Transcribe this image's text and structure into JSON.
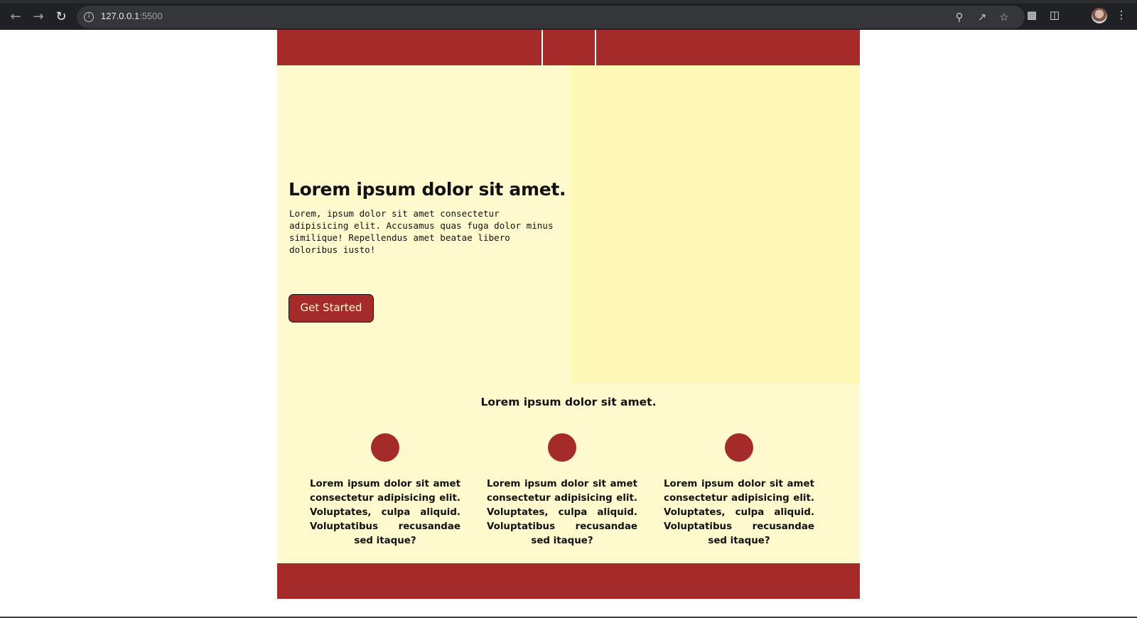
{
  "browser": {
    "url_host": "127.0.0.1",
    "url_port": ":5500"
  },
  "hero": {
    "title": "Lorem ipsum dolor sit amet.",
    "text": "Lorem, ipsum dolor sit amet consectetur adipisicing elit. Accusamus quas fuga dolor minus similique! Repellendus amet beatae libero doloribus iusto!",
    "button_label": "Get Started"
  },
  "features": {
    "title": "Lorem ipsum dolor sit amet.",
    "items": [
      {
        "text": "Lorem ipsum dolor sit amet consectetur adipisicing elit. Voluptates, culpa aliquid. Voluptatibus recusandae sed itaque?"
      },
      {
        "text": "Lorem ipsum dolor sit amet consectetur adipisicing elit. Voluptates, culpa aliquid. Voluptatibus recusandae sed itaque?"
      },
      {
        "text": "Lorem ipsum dolor sit amet consectetur adipisicing elit. Voluptates, culpa aliquid. Voluptatibus recusandae sed itaque?"
      }
    ]
  },
  "colors": {
    "brand": "#a52a2a",
    "page_background": "#fffacd",
    "hero_image_background": "#fff8b6"
  },
  "icons": [
    "back-arrow-icon",
    "forward-arrow-icon",
    "reload-icon",
    "info-icon",
    "zoom-icon",
    "share-icon",
    "star-icon",
    "extensions-icon",
    "sidepanel-icon",
    "menu-icon"
  ]
}
